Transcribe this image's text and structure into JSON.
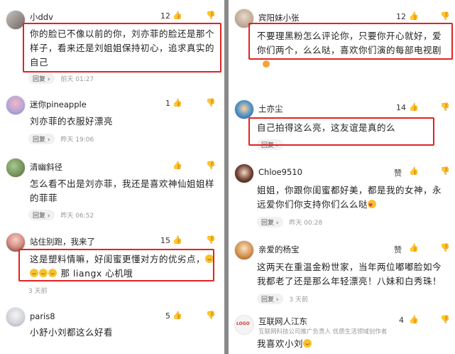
{
  "left": {
    "comments": [
      {
        "user": "小ddv",
        "likes": "12",
        "text": [
          "你的脸已不像以前的你，刘亦菲的脸还是那个",
          "样子，看来还是刘姐姐保持初心，追求真实的",
          "自己"
        ],
        "reply": "回复",
        "reply_arrow": "›",
        "time": "前天 01:27"
      },
      {
        "user": "迷你pineapple",
        "likes": "1",
        "text": [
          "刘亦菲的衣服好漂亮"
        ],
        "reply": "回复",
        "reply_arrow": "›",
        "time": "昨天 19:06"
      },
      {
        "user": "清幽斜径",
        "likes": "",
        "text": [
          "怎么看不出是刘亦菲，我还是喜欢神仙姐姐样",
          "的菲菲"
        ],
        "reply": "回复",
        "reply_arrow": "›",
        "time": "昨天 06:52"
      },
      {
        "user": "站住别跑，我来了",
        "likes": "15",
        "text": [
          "这是塑料情嘛，好闺蜜更懂对方的优劣点，",
          "那 liangx 心机哦"
        ],
        "reply": "",
        "reply_arrow": "",
        "time": "3 天前"
      },
      {
        "user": "paris8",
        "likes": "5",
        "text": [
          "小舒小刘都这么好看"
        ],
        "reply": "",
        "reply_arrow": "",
        "time": ""
      }
    ]
  },
  "right": {
    "comments": [
      {
        "user": "宾阳妹小张",
        "likes": "12",
        "text": [
          "不要理黑粉怎么评论你，只要你开心就好，爱",
          "你们两个，么么哒，喜欢你们演的每部电视剧"
        ],
        "reply": "",
        "reply_arrow": "",
        "time": ""
      },
      {
        "user": "土亦尘",
        "likes": "14",
        "text": [
          "自己拍得这么亮，这友谊是真的么"
        ],
        "reply": "回复",
        "reply_arrow": "›",
        "time": ""
      },
      {
        "user": "Chloe9510",
        "likes": "",
        "zan": "赞",
        "text": [
          "姐姐，你跟你闺蜜都好美，都是我的女神，永",
          "远爱你们你支持你们么么哒"
        ],
        "reply": "回复",
        "reply_arrow": "›",
        "time": "昨天 00:28"
      },
      {
        "user": "亲爱的杨宝",
        "likes": "",
        "zan": "赞",
        "text": [
          "这两天在重温金粉世家，当年两位嘟嘟脸如今",
          "我都老了还是那么年轻漂亮！八妹和白秀珠！"
        ],
        "reply": "回复",
        "reply_arrow": "›",
        "time": "3 天前"
      },
      {
        "user": "互联网人江东",
        "subtitle": "互联网科技公司推广负责人  优质生活领域创作者",
        "likes": "4",
        "text": [
          "我喜欢小刘"
        ],
        "reply": "",
        "reply_arrow": "",
        "time": ""
      }
    ],
    "avatar_badge": "LOGO"
  },
  "icons": {
    "like": "thumbs-up-icon",
    "dislike": "thumbs-down-icon"
  },
  "colors": {
    "highlight": "#e32222",
    "meta": "#999999",
    "divider": "#8a8a8a"
  }
}
